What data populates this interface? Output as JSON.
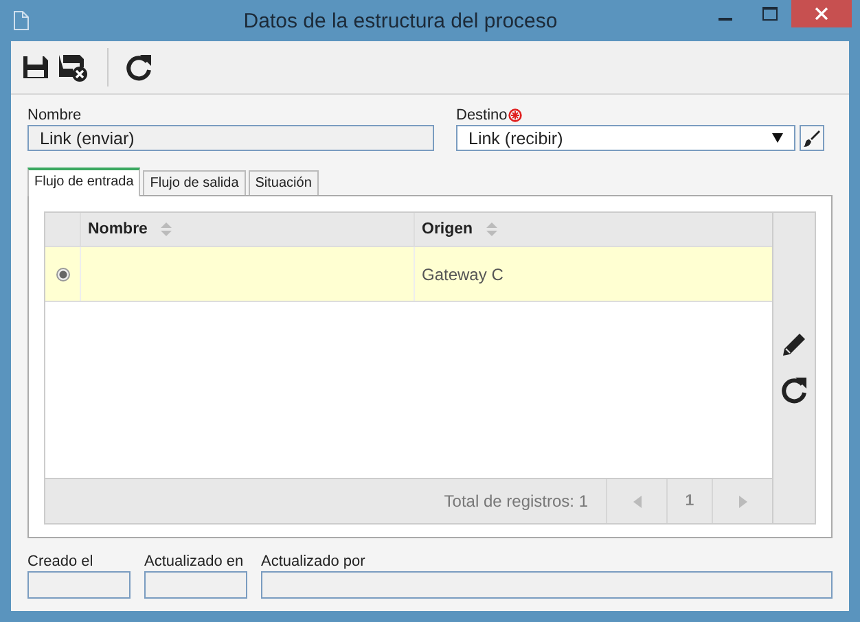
{
  "window": {
    "title": "Datos de la estructura del proceso"
  },
  "fields": [
    {
      "label": "Nombre",
      "value": "Link (enviar)",
      "disabled": true,
      "required": false,
      "kind": "text"
    },
    {
      "label": "Destino",
      "value": "Link (recibir)",
      "disabled": false,
      "required": true,
      "kind": "select"
    }
  ],
  "tabs": [
    {
      "label": "Flujo de entrada",
      "selected": true
    },
    {
      "label": "Flujo de salida",
      "selected": false
    },
    {
      "label": "Situación",
      "selected": false
    }
  ],
  "grid": {
    "columns": [
      "Nombre",
      "Origen"
    ],
    "rows": [
      {
        "selected": true,
        "origen": "Gateway C"
      }
    ],
    "total": "Total de registros: 1",
    "page": "1"
  },
  "audit": [
    {
      "label": "Creado el"
    },
    {
      "label": "Actualizado en"
    },
    {
      "label": "Actualizado por"
    }
  ]
}
